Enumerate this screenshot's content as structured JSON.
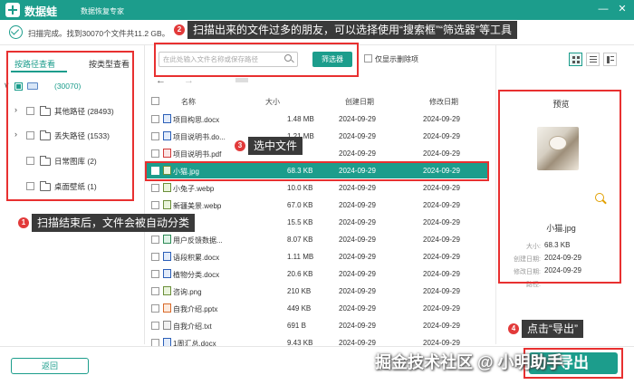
{
  "app": {
    "name": "数据蛙",
    "subtitle": "数据恢复专家",
    "status": "扫描完成。找到30070个文件共11.2 GB。"
  },
  "window": {
    "minimize": "—",
    "close": "✕"
  },
  "callouts": [
    {
      "num": "2",
      "text": "扫描出来的文件过多的朋友，可以选择使用“搜索框”“筛选器”等工具"
    },
    {
      "num": "3",
      "text": "选中文件"
    },
    {
      "num": "1",
      "text": "扫描结束后，文件会被自动分类"
    },
    {
      "num": "4",
      "text": "点击“导出”"
    }
  ],
  "toolbar": {
    "search_placeholder": "在此处输入文件名称或保存路径",
    "filter_label": "筛选器",
    "deleted_only_label": "仅显示删除项"
  },
  "sidebar": {
    "tab_path": "按路径查看",
    "tab_type": "按类型查看",
    "root_count": "(30070)",
    "items": [
      {
        "label": "其他路径 (28493)"
      },
      {
        "label": "丢失路径 (1533)"
      },
      {
        "label": "日常图库 (2)"
      },
      {
        "label": "桌面壁纸 (1)"
      }
    ]
  },
  "table": {
    "headers": [
      "名称",
      "大小",
      "创建日期",
      "修改日期"
    ],
    "rows": [
      {
        "name": "项目构思.docx",
        "size": "1.48 MB",
        "created": "2024-09-29",
        "modified": "2024-09-29",
        "type": "word"
      },
      {
        "name": "项目说明书.do...",
        "size": "1.21 MB",
        "created": "2024-09-29",
        "modified": "2024-09-29",
        "type": "word"
      },
      {
        "name": "项目说明书.pdf",
        "size": "",
        "created": "2024-09-29",
        "modified": "2024-09-29",
        "type": "pdf"
      },
      {
        "name": "小猫.jpg",
        "size": "68.3 KB",
        "created": "2024-09-29",
        "modified": "2024-09-29",
        "type": "img",
        "selected": true
      },
      {
        "name": "小兔子.webp",
        "size": "10.0 KB",
        "created": "2024-09-29",
        "modified": "2024-09-29",
        "type": "img"
      },
      {
        "name": "新疆美景.webp",
        "size": "67.0 KB",
        "created": "2024-09-29",
        "modified": "2024-09-29",
        "type": "img"
      },
      {
        "name": "",
        "size": "15.5 KB",
        "created": "2024-09-29",
        "modified": "2024-09-29",
        "type": "img"
      },
      {
        "name": "用户反馈数据...",
        "size": "8.07 KB",
        "created": "2024-09-29",
        "modified": "2024-09-29",
        "type": "xls"
      },
      {
        "name": "语段积累.docx",
        "size": "1.11 MB",
        "created": "2024-09-29",
        "modified": "2024-09-29",
        "type": "word"
      },
      {
        "name": "植物分类.docx",
        "size": "20.6 KB",
        "created": "2024-09-29",
        "modified": "2024-09-29",
        "type": "word"
      },
      {
        "name": "咨询.png",
        "size": "210 KB",
        "created": "2024-09-29",
        "modified": "2024-09-29",
        "type": "img"
      },
      {
        "name": "自我介绍.pptx",
        "size": "449 KB",
        "created": "2024-09-29",
        "modified": "2024-09-29",
        "type": "ppt"
      },
      {
        "name": "自我介绍.txt",
        "size": "691 B",
        "created": "2024-09-29",
        "modified": "2024-09-29",
        "type": "txt"
      },
      {
        "name": "1周汇总.docx",
        "size": "9.43 KB",
        "created": "2024-09-29",
        "modified": "2024-09-29",
        "type": "word"
      }
    ]
  },
  "preview": {
    "title": "预览",
    "filename": "小猫.jpg",
    "size_label": "大小:",
    "size": "68.3 KB",
    "created_label": "创建日期:",
    "created": "2024-09-29",
    "modified_label": "修改日期:",
    "modified": "2024-09-29",
    "path_label": "路径:"
  },
  "footer": {
    "back_label": "返回",
    "export_label": "导出",
    "watermark": "掘金技术社区 @ 小明助手"
  },
  "colors": {
    "accent": "#1c9d8c",
    "highlight": "#e83030"
  }
}
